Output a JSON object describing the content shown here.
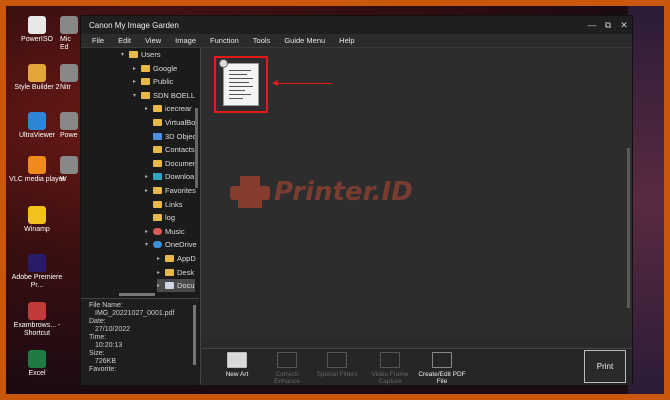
{
  "desktop": {
    "icons": [
      {
        "label": "PowerISO",
        "color": "#e8e8e8"
      },
      {
        "label": "Style Builder 2",
        "color": "#e6a53a"
      },
      {
        "label": "UltraViewer",
        "color": "#2f86d8"
      },
      {
        "label": "VLC media player",
        "color": "#f08a1c"
      },
      {
        "label": "Winamp",
        "color": "#f3c21a"
      },
      {
        "label": "Adobe Premiere Pr...",
        "color": "#2a1a6a"
      },
      {
        "label": "Exambrows... - Shortcut",
        "color": "#c23b3b"
      },
      {
        "label": "Excel",
        "color": "#1f7a43"
      }
    ],
    "partial_labels": [
      "Mic Ed",
      "Nitr",
      "Powe",
      "W"
    ]
  },
  "window": {
    "title": "Canon My Image Garden",
    "controls": {
      "minimize": "—",
      "restore": "⧉",
      "close": "✕"
    }
  },
  "menu": [
    "File",
    "Edit",
    "View",
    "Image",
    "Function",
    "Tools",
    "Guide Menu",
    "Help"
  ],
  "tree": [
    {
      "label": "Users",
      "type": "folder",
      "arrow": "▾"
    },
    {
      "label": "Google",
      "type": "folder",
      "arrow": "▸"
    },
    {
      "label": "Public",
      "type": "folder",
      "arrow": "▸"
    },
    {
      "label": "SDN BOELL",
      "type": "folder",
      "arrow": "▾"
    },
    {
      "label": "icecrear",
      "type": "folder",
      "arrow": "▸"
    },
    {
      "label": "VirtualBo",
      "type": "folder",
      "arrow": ""
    },
    {
      "label": "3D Objec",
      "type": "blue",
      "arrow": ""
    },
    {
      "label": "Contacts",
      "type": "folder",
      "arrow": ""
    },
    {
      "label": "Documen",
      "type": "folder",
      "arrow": ""
    },
    {
      "label": "Downloa",
      "type": "dl",
      "arrow": "▸"
    },
    {
      "label": "Favorites",
      "type": "folder",
      "arrow": "▸"
    },
    {
      "label": "Links",
      "type": "folder",
      "arrow": ""
    },
    {
      "label": "log",
      "type": "folder",
      "arrow": ""
    },
    {
      "label": "Music",
      "type": "music",
      "arrow": "▸"
    },
    {
      "label": "OneDrive",
      "type": "cloud",
      "arrow": "▾"
    },
    {
      "label": "AppD",
      "type": "folder",
      "arrow": "▸"
    },
    {
      "label": "Desk",
      "type": "folder",
      "arrow": "▸"
    },
    {
      "label": "Docu",
      "type": "doc",
      "arrow": "▸",
      "selected": true
    }
  ],
  "file_info": {
    "name_label": "File Name:",
    "name_value": "IMG_20221027_0001.pdf",
    "date_label": "Date:",
    "date_value": "27/10/2022",
    "time_label": "Time:",
    "time_value": "10:20:13",
    "size_label": "Size:",
    "size_value": "726KB",
    "favorite_label": "Favorite:"
  },
  "watermark": {
    "text": "Printer.ID"
  },
  "toolbar": {
    "new_art": "New Art",
    "correct_enhance": "Correct/ Enhance",
    "special_filters": "Special Filters",
    "video_frame_capture": "Video Frame Capture",
    "create_edit_pdf": "Create/Edit PDF File",
    "print": "Print"
  }
}
